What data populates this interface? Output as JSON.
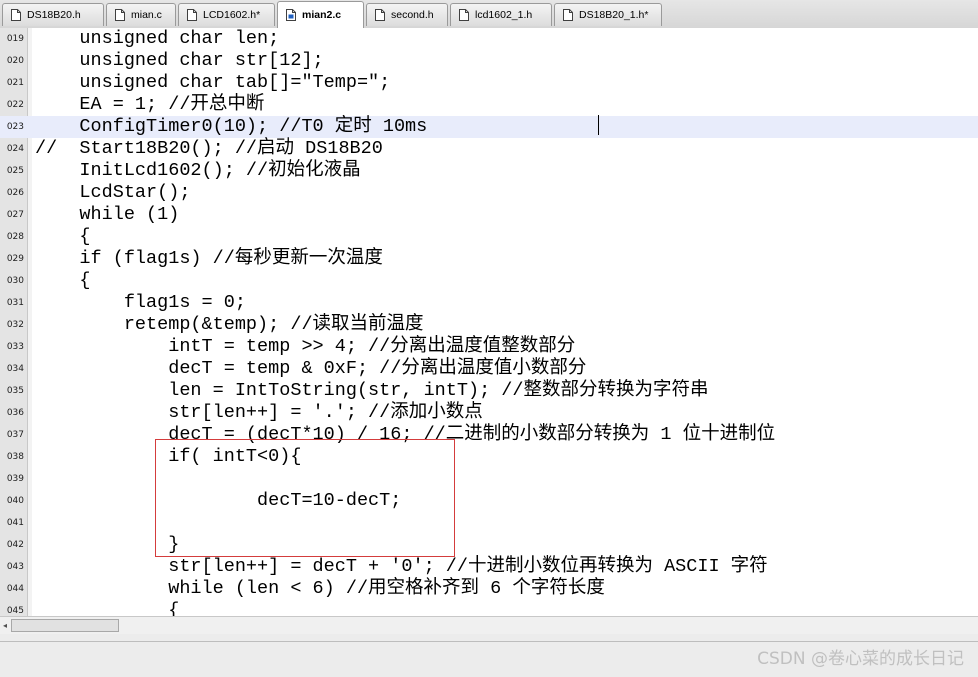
{
  "tabs": [
    {
      "label": "DS18B20.h",
      "active": false
    },
    {
      "label": "mian.c",
      "active": false
    },
    {
      "label": "LCD1602.h*",
      "active": false
    },
    {
      "label": "mian2.c",
      "active": true
    },
    {
      "label": "second.h",
      "active": false
    },
    {
      "label": "lcd1602_1.h",
      "active": false
    },
    {
      "label": "DS18B20_1.h*",
      "active": false
    }
  ],
  "editor": {
    "current_line": "023",
    "lines": [
      {
        "num": "019",
        "text": "    unsigned char len;"
      },
      {
        "num": "020",
        "text": "    unsigned char str[12];"
      },
      {
        "num": "021",
        "text": "    unsigned char tab[]=\"Temp=\";"
      },
      {
        "num": "022",
        "text": "    EA = 1; //开总中断"
      },
      {
        "num": "023",
        "text": "    ConfigTimer0(10); //T0 定时 10ms"
      },
      {
        "num": "024",
        "text": "//  Start18B20(); //启动 DS18B20"
      },
      {
        "num": "025",
        "text": "    InitLcd1602(); //初始化液晶"
      },
      {
        "num": "026",
        "text": "    LcdStar();"
      },
      {
        "num": "027",
        "text": "    while (1)"
      },
      {
        "num": "028",
        "text": "    {"
      },
      {
        "num": "029",
        "text": "    if (flag1s) //每秒更新一次温度"
      },
      {
        "num": "030",
        "text": "    {"
      },
      {
        "num": "031",
        "text": "        flag1s = 0;"
      },
      {
        "num": "032",
        "text": "        retemp(&temp); //读取当前温度"
      },
      {
        "num": "033",
        "text": "            intT = temp >> 4; //分离出温度值整数部分"
      },
      {
        "num": "034",
        "text": "            decT = temp & 0xF; //分离出温度值小数部分"
      },
      {
        "num": "035",
        "text": "            len = IntToString(str, intT); //整数部分转换为字符串"
      },
      {
        "num": "036",
        "text": "            str[len++] = '.'; //添加小数点"
      },
      {
        "num": "037",
        "text": "            decT = (decT*10) / 16; //二进制的小数部分转换为 1 位十进制位"
      },
      {
        "num": "038",
        "text": "            if( intT<0){"
      },
      {
        "num": "039",
        "text": ""
      },
      {
        "num": "040",
        "text": "                    decT=10-decT;"
      },
      {
        "num": "041",
        "text": ""
      },
      {
        "num": "042",
        "text": "            }"
      },
      {
        "num": "043",
        "text": "            str[len++] = decT + '0'; //十进制小数位再转换为 ASCII 字符"
      },
      {
        "num": "044",
        "text": "            while (len < 6) //用空格补齐到 6 个字符长度"
      },
      {
        "num": "045",
        "text": "            {"
      }
    ]
  },
  "scrollbar": {
    "left_arrow": "◂"
  },
  "watermark": "CSDN @卷心菜的成长日记"
}
